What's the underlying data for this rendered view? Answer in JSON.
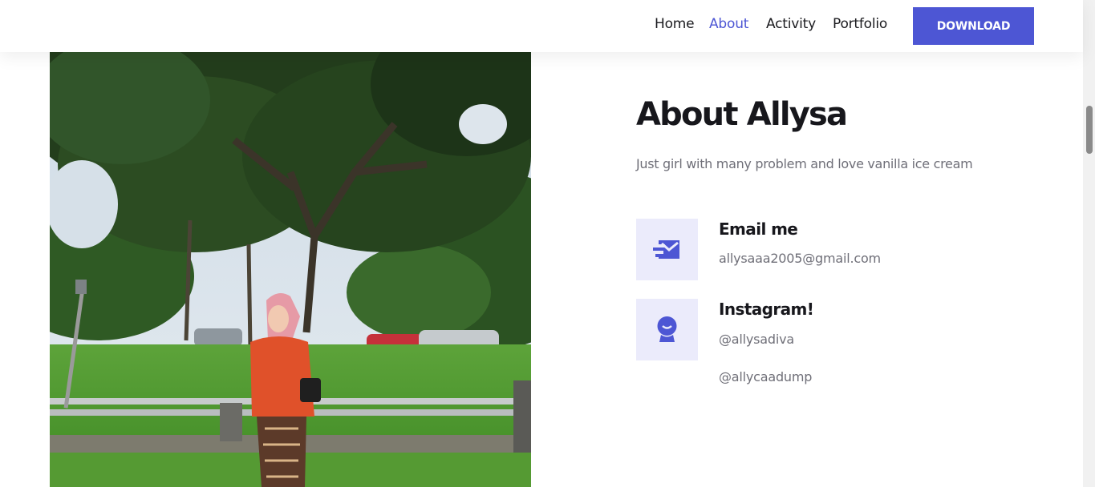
{
  "nav": {
    "items": [
      {
        "label": "Home"
      },
      {
        "label": "About"
      },
      {
        "label": "Activity"
      },
      {
        "label": "Portfolio"
      }
    ],
    "active": "About",
    "download_label": "DOWNLOAD"
  },
  "about": {
    "heading": "About Allysa",
    "subtitle": "Just girl with many problem and love vanilla ice cream",
    "email": {
      "title": "Email me",
      "value": "allysaaa2005@gmail.com",
      "icon": "mail-icon"
    },
    "instagram": {
      "title": "Instagram!",
      "handles": [
        "@allysadiva",
        "@allycaadump"
      ],
      "icon": "profile-icon"
    }
  },
  "colors": {
    "accent": "#4d56d4",
    "icon_bg": "#ebebfb",
    "text_dark": "#17171c",
    "text_muted": "#6f6f78"
  }
}
